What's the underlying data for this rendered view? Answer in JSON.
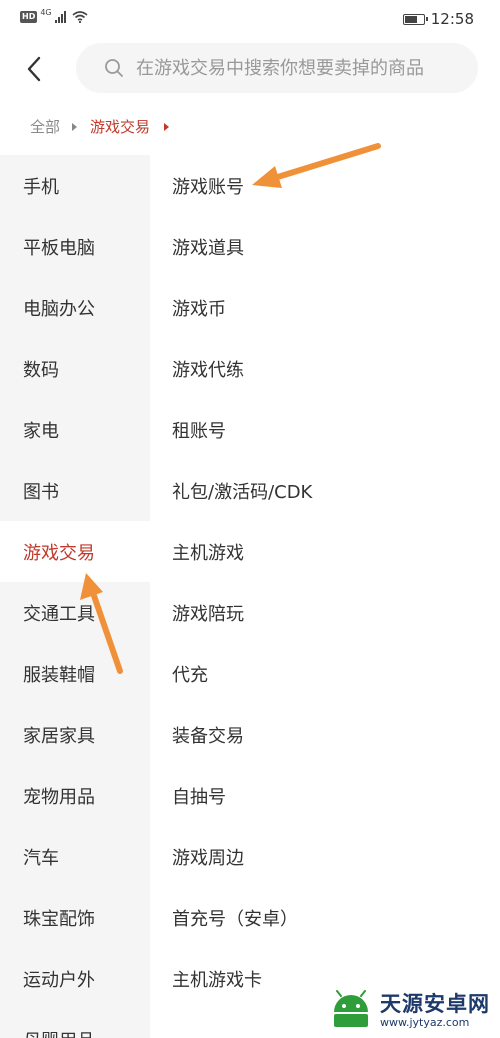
{
  "status_bar": {
    "hd_badge": "HD",
    "network": "4G",
    "time": "12:58",
    "battery_level": 0.7
  },
  "header": {
    "search_placeholder": "在游戏交易中搜索你想要卖掉的商品"
  },
  "breadcrumb": {
    "items": [
      "全部",
      "游戏交易"
    ]
  },
  "sidebar": {
    "items": [
      "手机",
      "平板电脑",
      "电脑办公",
      "数码",
      "家电",
      "图书",
      "游戏交易",
      "交通工具",
      "服装鞋帽",
      "家居家具",
      "宠物用品",
      "汽车",
      "珠宝配饰",
      "运动户外",
      "母婴用品"
    ],
    "active_index": 6
  },
  "categories": {
    "items": [
      "游戏账号",
      "游戏道具",
      "游戏币",
      "游戏代练",
      "租账号",
      "礼包/激活码/CDK",
      "主机游戏",
      "游戏陪玩",
      "代充",
      "装备交易",
      "自抽号",
      "游戏周边",
      "首充号（安卓）",
      "主机游戏卡"
    ]
  },
  "watermark": {
    "title": "天源安卓网",
    "url": "www.jytyaz.com"
  },
  "colors": {
    "accent": "#c0392b",
    "annotation_arrow": "#f0913a",
    "sidebar_bg": "#f5f5f5"
  },
  "icons": [
    "back-arrow-icon",
    "search-icon",
    "signal-icon",
    "wifi-icon",
    "battery-icon",
    "caret-right-icon"
  ]
}
